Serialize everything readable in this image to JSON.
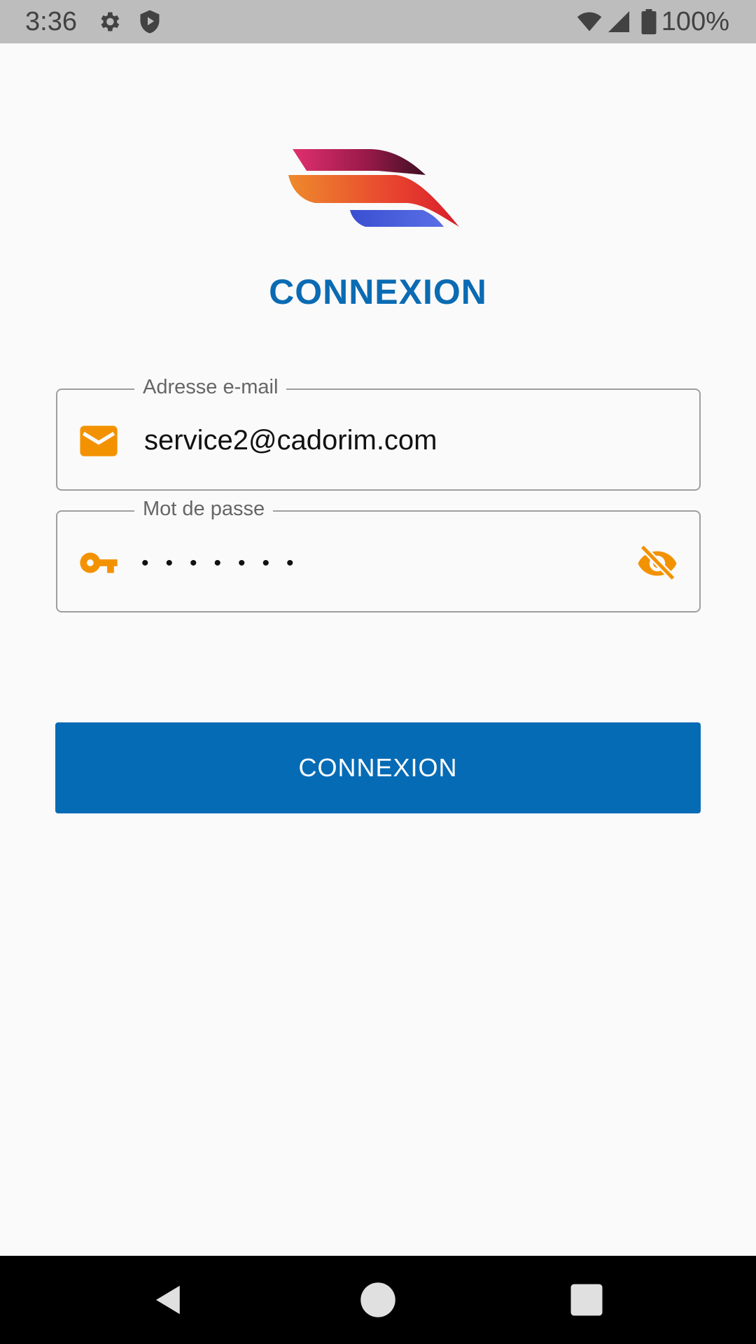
{
  "status_bar": {
    "time": "3:36",
    "battery_text": "100%",
    "icons": [
      "gear-icon",
      "shield-play-icon",
      "wifi-icon",
      "signal-icon",
      "battery-icon"
    ]
  },
  "login": {
    "title": "CONNEXION",
    "email": {
      "label": "Adresse e-mail",
      "value": "service2@cadorim.com",
      "icon": "mail-icon"
    },
    "password": {
      "label": "Mot de passe",
      "masked_value": "•••••••",
      "icon": "key-icon",
      "toggle_icon": "eye-off-icon"
    },
    "button_label": "CONNEXION"
  },
  "colors": {
    "brand_blue": "#0a6bb3",
    "accent_orange": "#f39200",
    "status_bar_bg": "#bdbdbd"
  }
}
